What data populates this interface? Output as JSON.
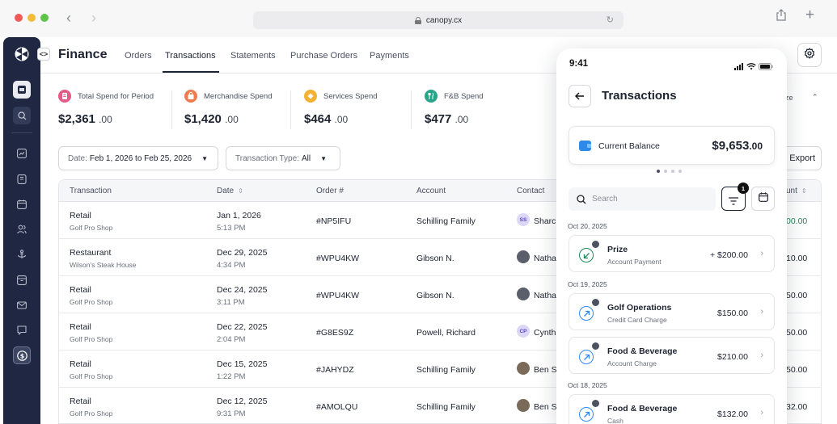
{
  "browser": {
    "url": "canopy.cx"
  },
  "header": {
    "title": "Finance",
    "tabs": [
      {
        "label": "Orders"
      },
      {
        "label": "Transactions"
      },
      {
        "label": "Statements"
      },
      {
        "label": "Purchase Orders"
      },
      {
        "label": "Payments"
      }
    ],
    "active_tab": "Transactions"
  },
  "stats": [
    {
      "label": "Total Spend for Period",
      "value": "$2,361",
      "cents": ".00",
      "color": "#e45b86"
    },
    {
      "label": "Merchandise Spend",
      "value": "$1,420",
      "cents": ".00",
      "color": "#f07b4f"
    },
    {
      "label": "Services Spend",
      "value": "$464",
      "cents": ".00",
      "color": "#f2b233"
    },
    {
      "label": "F&B Spend",
      "value": "$477",
      "cents": ".00",
      "color": "#27a58a"
    }
  ],
  "filters": {
    "date_key": "Date:",
    "date_value": "Feb 1, 2026 to Feb 25, 2026",
    "type_key": "Transaction Type:",
    "type_value": "All"
  },
  "right_partial": {
    "size_text": "ze",
    "export_label": "Export",
    "amount_header": "unt"
  },
  "table": {
    "columns": [
      "Transaction",
      "Date",
      "Order #",
      "Account",
      "Contact"
    ],
    "rows": [
      {
        "type": "Retail",
        "location": "Golf Pro Shop",
        "date": "Jan 1, 2026",
        "time": "5:13 PM",
        "order": "#NP5IFU",
        "account": "Schilling Family",
        "initials": "SS",
        "contact": "Sharc",
        "amount_partial": "00.00"
      },
      {
        "type": "Restaurant",
        "location": "Wilson's Steak House",
        "date": "Dec 29, 2025",
        "time": "4:34 PM",
        "order": "#WPU4KW",
        "account": "Gibson N.",
        "initials": "",
        "contact": "Natha",
        "amount_partial": "10.00"
      },
      {
        "type": "Retail",
        "location": "Golf Pro Shop",
        "date": "Dec 24, 2025",
        "time": "3:11 PM",
        "order": "#WPU4KW",
        "account": "Gibson N.",
        "initials": "",
        "contact": "Natha",
        "amount_partial": "50.00"
      },
      {
        "type": "Retail",
        "location": "Golf Pro Shop",
        "date": "Dec 22, 2025",
        "time": "2:04 PM",
        "order": "#G8ES9Z",
        "account": "Powell, Richard",
        "initials": "CP",
        "contact": "Cynth",
        "amount_partial": "50.00"
      },
      {
        "type": "Retail",
        "location": "Golf Pro Shop",
        "date": "Dec 15, 2025",
        "time": "1:22 PM",
        "order": "#JAHYDZ",
        "account": "Schilling Family",
        "initials": "",
        "contact": "Ben S",
        "amount_partial": "50.00"
      },
      {
        "type": "Retail",
        "location": "Golf Pro Shop",
        "date": "Dec 12, 2025",
        "time": "9:31 PM",
        "order": "#AMOLQU",
        "account": "Schilling Family",
        "initials": "",
        "contact": "Ben S",
        "amount_partial": "32.00"
      }
    ]
  },
  "phone": {
    "time": "9:41",
    "title": "Transactions",
    "balance_label": "Current Balance",
    "balance_value": "$9,653",
    "balance_cents": ".00",
    "search_placeholder": "Search",
    "filter_count": "1",
    "groups": [
      {
        "date": "Oct 20, 2025"
      },
      {
        "date": "Oct 19, 2025"
      },
      {
        "date": "Oct 18, 2025"
      }
    ],
    "transactions": [
      {
        "title": "Prize",
        "subtitle": "Account Payment",
        "amount": "+ $200.00"
      },
      {
        "title": "Golf Operations",
        "subtitle": "Credit Card Charge",
        "amount": "$150.00"
      },
      {
        "title": "Food & Beverage",
        "subtitle": "Account Charge",
        "amount": "$210.00"
      },
      {
        "title": "Food & Beverage",
        "subtitle": "Cash",
        "amount": "$132.00"
      }
    ]
  }
}
